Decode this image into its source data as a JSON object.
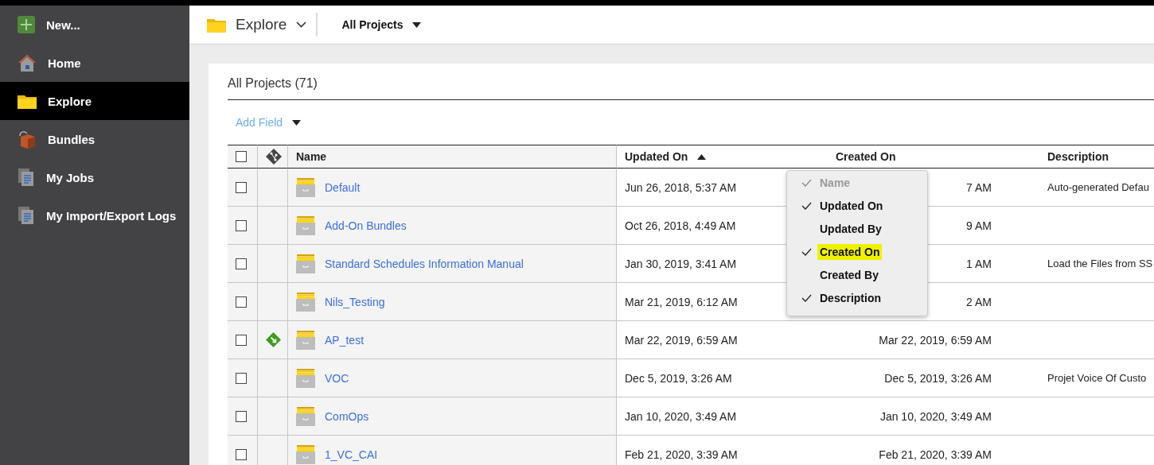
{
  "sidebar": {
    "items": [
      {
        "label": "New...",
        "kind": "new",
        "selected": false
      },
      {
        "label": "Home",
        "kind": "home",
        "selected": false
      },
      {
        "label": "Explore",
        "kind": "folder",
        "selected": true
      },
      {
        "label": "Bundles",
        "kind": "bundle",
        "selected": false
      },
      {
        "label": "My Jobs",
        "kind": "jobs",
        "selected": false
      },
      {
        "label": "My Import/Export Logs",
        "kind": "logs",
        "selected": false
      }
    ]
  },
  "topbar": {
    "view": "Explore",
    "scope": "All Projects"
  },
  "card": {
    "title": "All Projects (71)",
    "add_field": "Add Field",
    "table": {
      "select_all": {
        "checked": false
      },
      "columns": [
        {
          "label": "Name"
        },
        {
          "label": "Updated On",
          "sorted": true
        },
        {
          "label": "Created On"
        },
        {
          "label": "Description"
        }
      ],
      "rows": [
        {
          "checked": false,
          "checked_out": false,
          "name": "Default",
          "updated": "Jun 26, 2018, 5:37 AM",
          "created": "7 AM",
          "description": "Auto-generated Defau"
        },
        {
          "checked": false,
          "checked_out": false,
          "name": "Add-On Bundles",
          "updated": "Oct 26, 2018, 4:49 AM",
          "created": "9 AM",
          "description": ""
        },
        {
          "checked": false,
          "checked_out": false,
          "name": "Standard Schedules Information Manual",
          "updated": "Jan 30, 2019, 3:41 AM",
          "created": "1 AM",
          "description": "Load the Files from SS"
        },
        {
          "checked": false,
          "checked_out": false,
          "name": "Nils_Testing",
          "updated": "Mar 21, 2019, 6:12 AM",
          "created": "2 AM",
          "description": ""
        },
        {
          "checked": false,
          "checked_out": true,
          "name": "AP_test",
          "updated": "Mar 22, 2019, 6:59 AM",
          "created": "Mar 22, 2019, 6:59 AM",
          "description": ""
        },
        {
          "checked": false,
          "checked_out": false,
          "name": "VOC",
          "updated": "Dec 5, 2019, 3:26 AM",
          "created": "Dec 5, 2019, 3:26 AM",
          "description": "Projet Voice Of Custo"
        },
        {
          "checked": false,
          "checked_out": false,
          "name": "ComOps",
          "updated": "Jan 10, 2020, 3:49 AM",
          "created": "Jan 10, 2020, 3:49 AM",
          "description": ""
        },
        {
          "checked": false,
          "checked_out": false,
          "name": "1_VC_CAI",
          "updated": "Feb 21, 2020, 3:39 AM",
          "created": "Feb 21, 2020, 3:39 AM",
          "description": ""
        }
      ]
    },
    "column_menu": {
      "items": [
        {
          "label": "Name",
          "checked": true,
          "disabled": true,
          "highlighted": false
        },
        {
          "label": "Updated On",
          "checked": true,
          "disabled": false,
          "highlighted": false
        },
        {
          "label": "Updated By",
          "checked": false,
          "disabled": false,
          "highlighted": false
        },
        {
          "label": "Created On",
          "checked": true,
          "disabled": false,
          "highlighted": true
        },
        {
          "label": "Created By",
          "checked": false,
          "disabled": false,
          "highlighted": false
        },
        {
          "label": "Description",
          "checked": true,
          "disabled": false,
          "highlighted": false
        }
      ]
    }
  }
}
